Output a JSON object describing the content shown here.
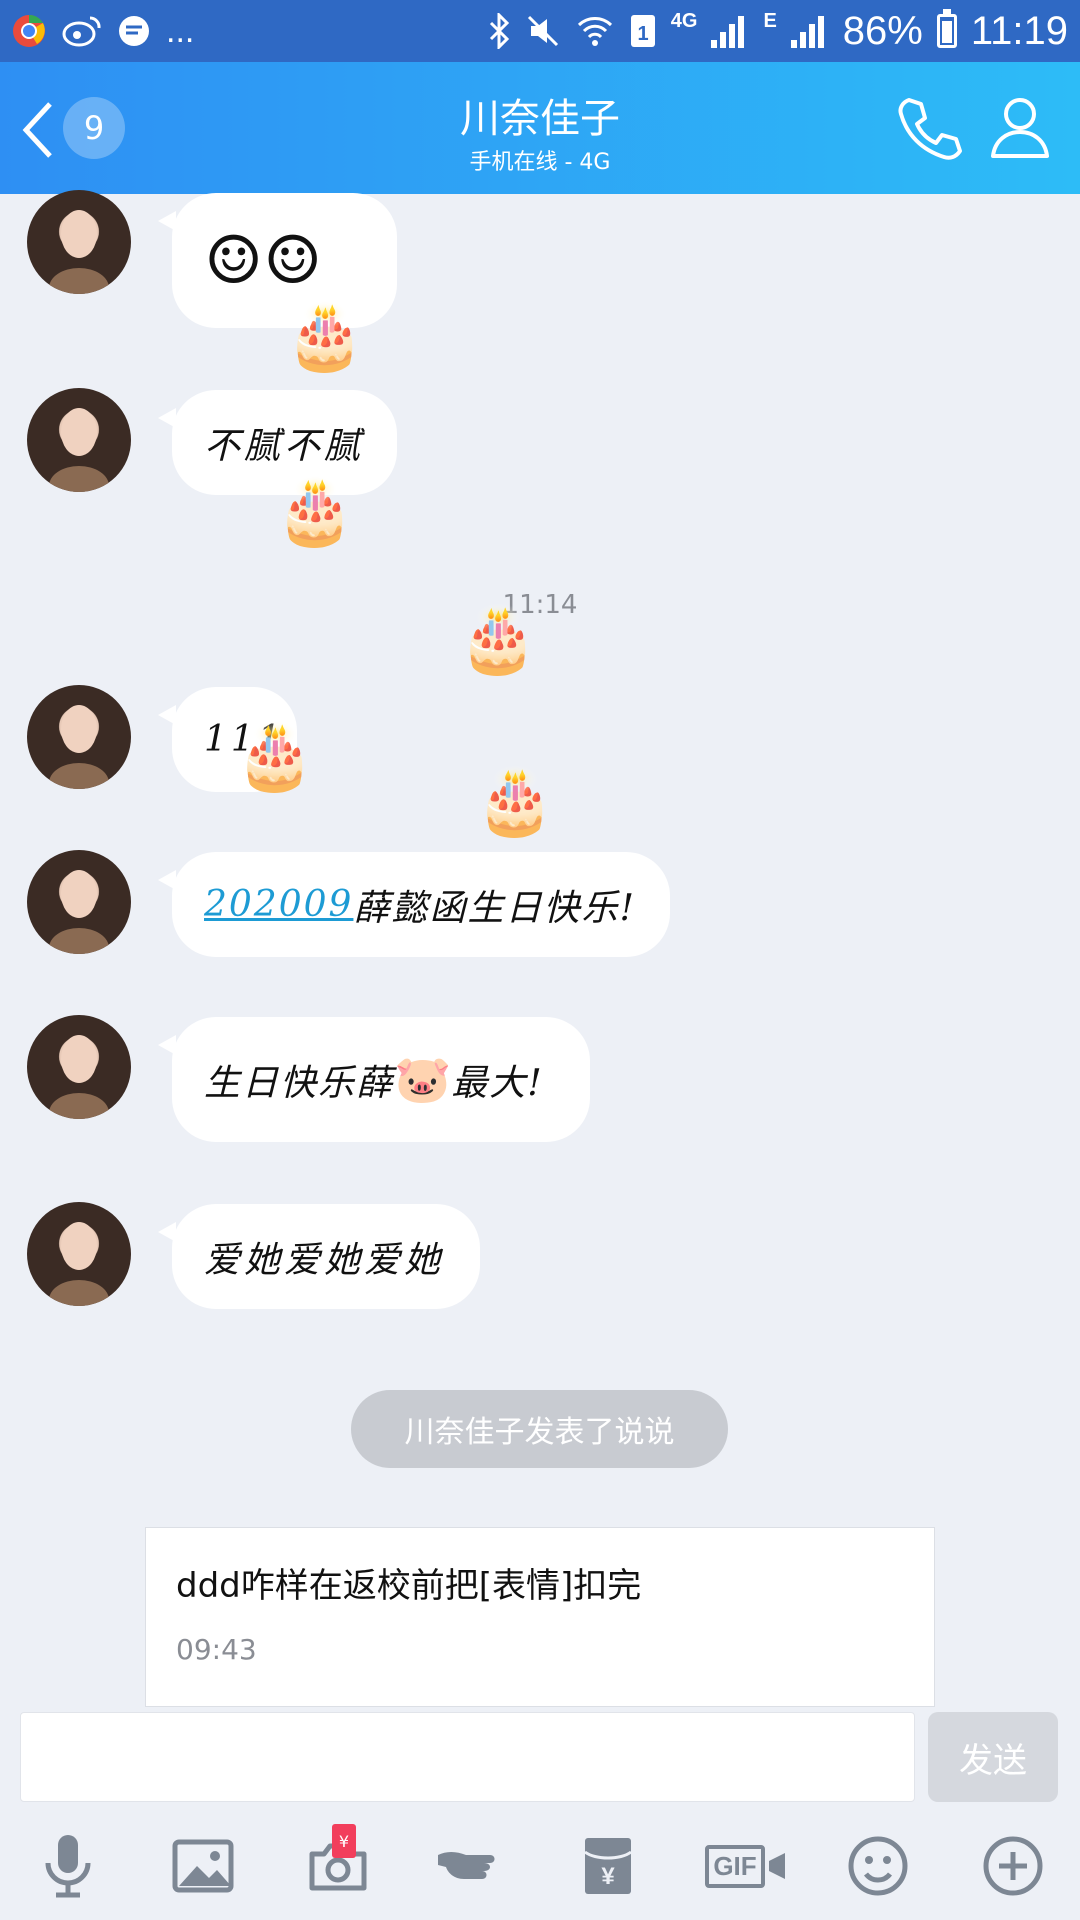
{
  "status_bar": {
    "more": "...",
    "network_4g": "4G",
    "network_e": "E",
    "battery": "86%",
    "time": "11:19"
  },
  "header": {
    "unread_count": "9",
    "contact_name": "川奈佳子",
    "status": "手机在线 - 4G"
  },
  "messages": [
    {
      "type": "emoji",
      "text": "☺☺"
    },
    {
      "type": "text",
      "text": "不腻不腻"
    },
    {
      "type": "text",
      "text": "111"
    },
    {
      "type": "text",
      "link": "202009",
      "text": "薛懿函生日快乐!"
    },
    {
      "type": "text",
      "text": "生日快乐薛",
      "emoji": "🐷",
      "text_after": "最大!"
    },
    {
      "type": "text",
      "text": "爱她爱她爱她"
    }
  ],
  "timestamp": "11:14",
  "cake_emoji": "🎂",
  "notice": "川奈佳子发表了说说",
  "post_card": {
    "text": "ddd咋样在返校前把[表情]扣完",
    "time": "09:43"
  },
  "input": {
    "send_label": "发送"
  },
  "toolbar": {
    "red_packet_symbol": "¥",
    "gif_label": "GIF",
    "icons": [
      "microphone-icon",
      "image-icon",
      "camera-icon",
      "poke-icon",
      "red-envelope-icon",
      "gif-icon",
      "emoji-icon",
      "plus-icon"
    ]
  },
  "colors": {
    "header_start": "#2e8ff3",
    "header_end": "#2dbcf7",
    "status_bar": "#2f69c4",
    "background": "#edf0f6",
    "link": "#1d9bd4"
  }
}
